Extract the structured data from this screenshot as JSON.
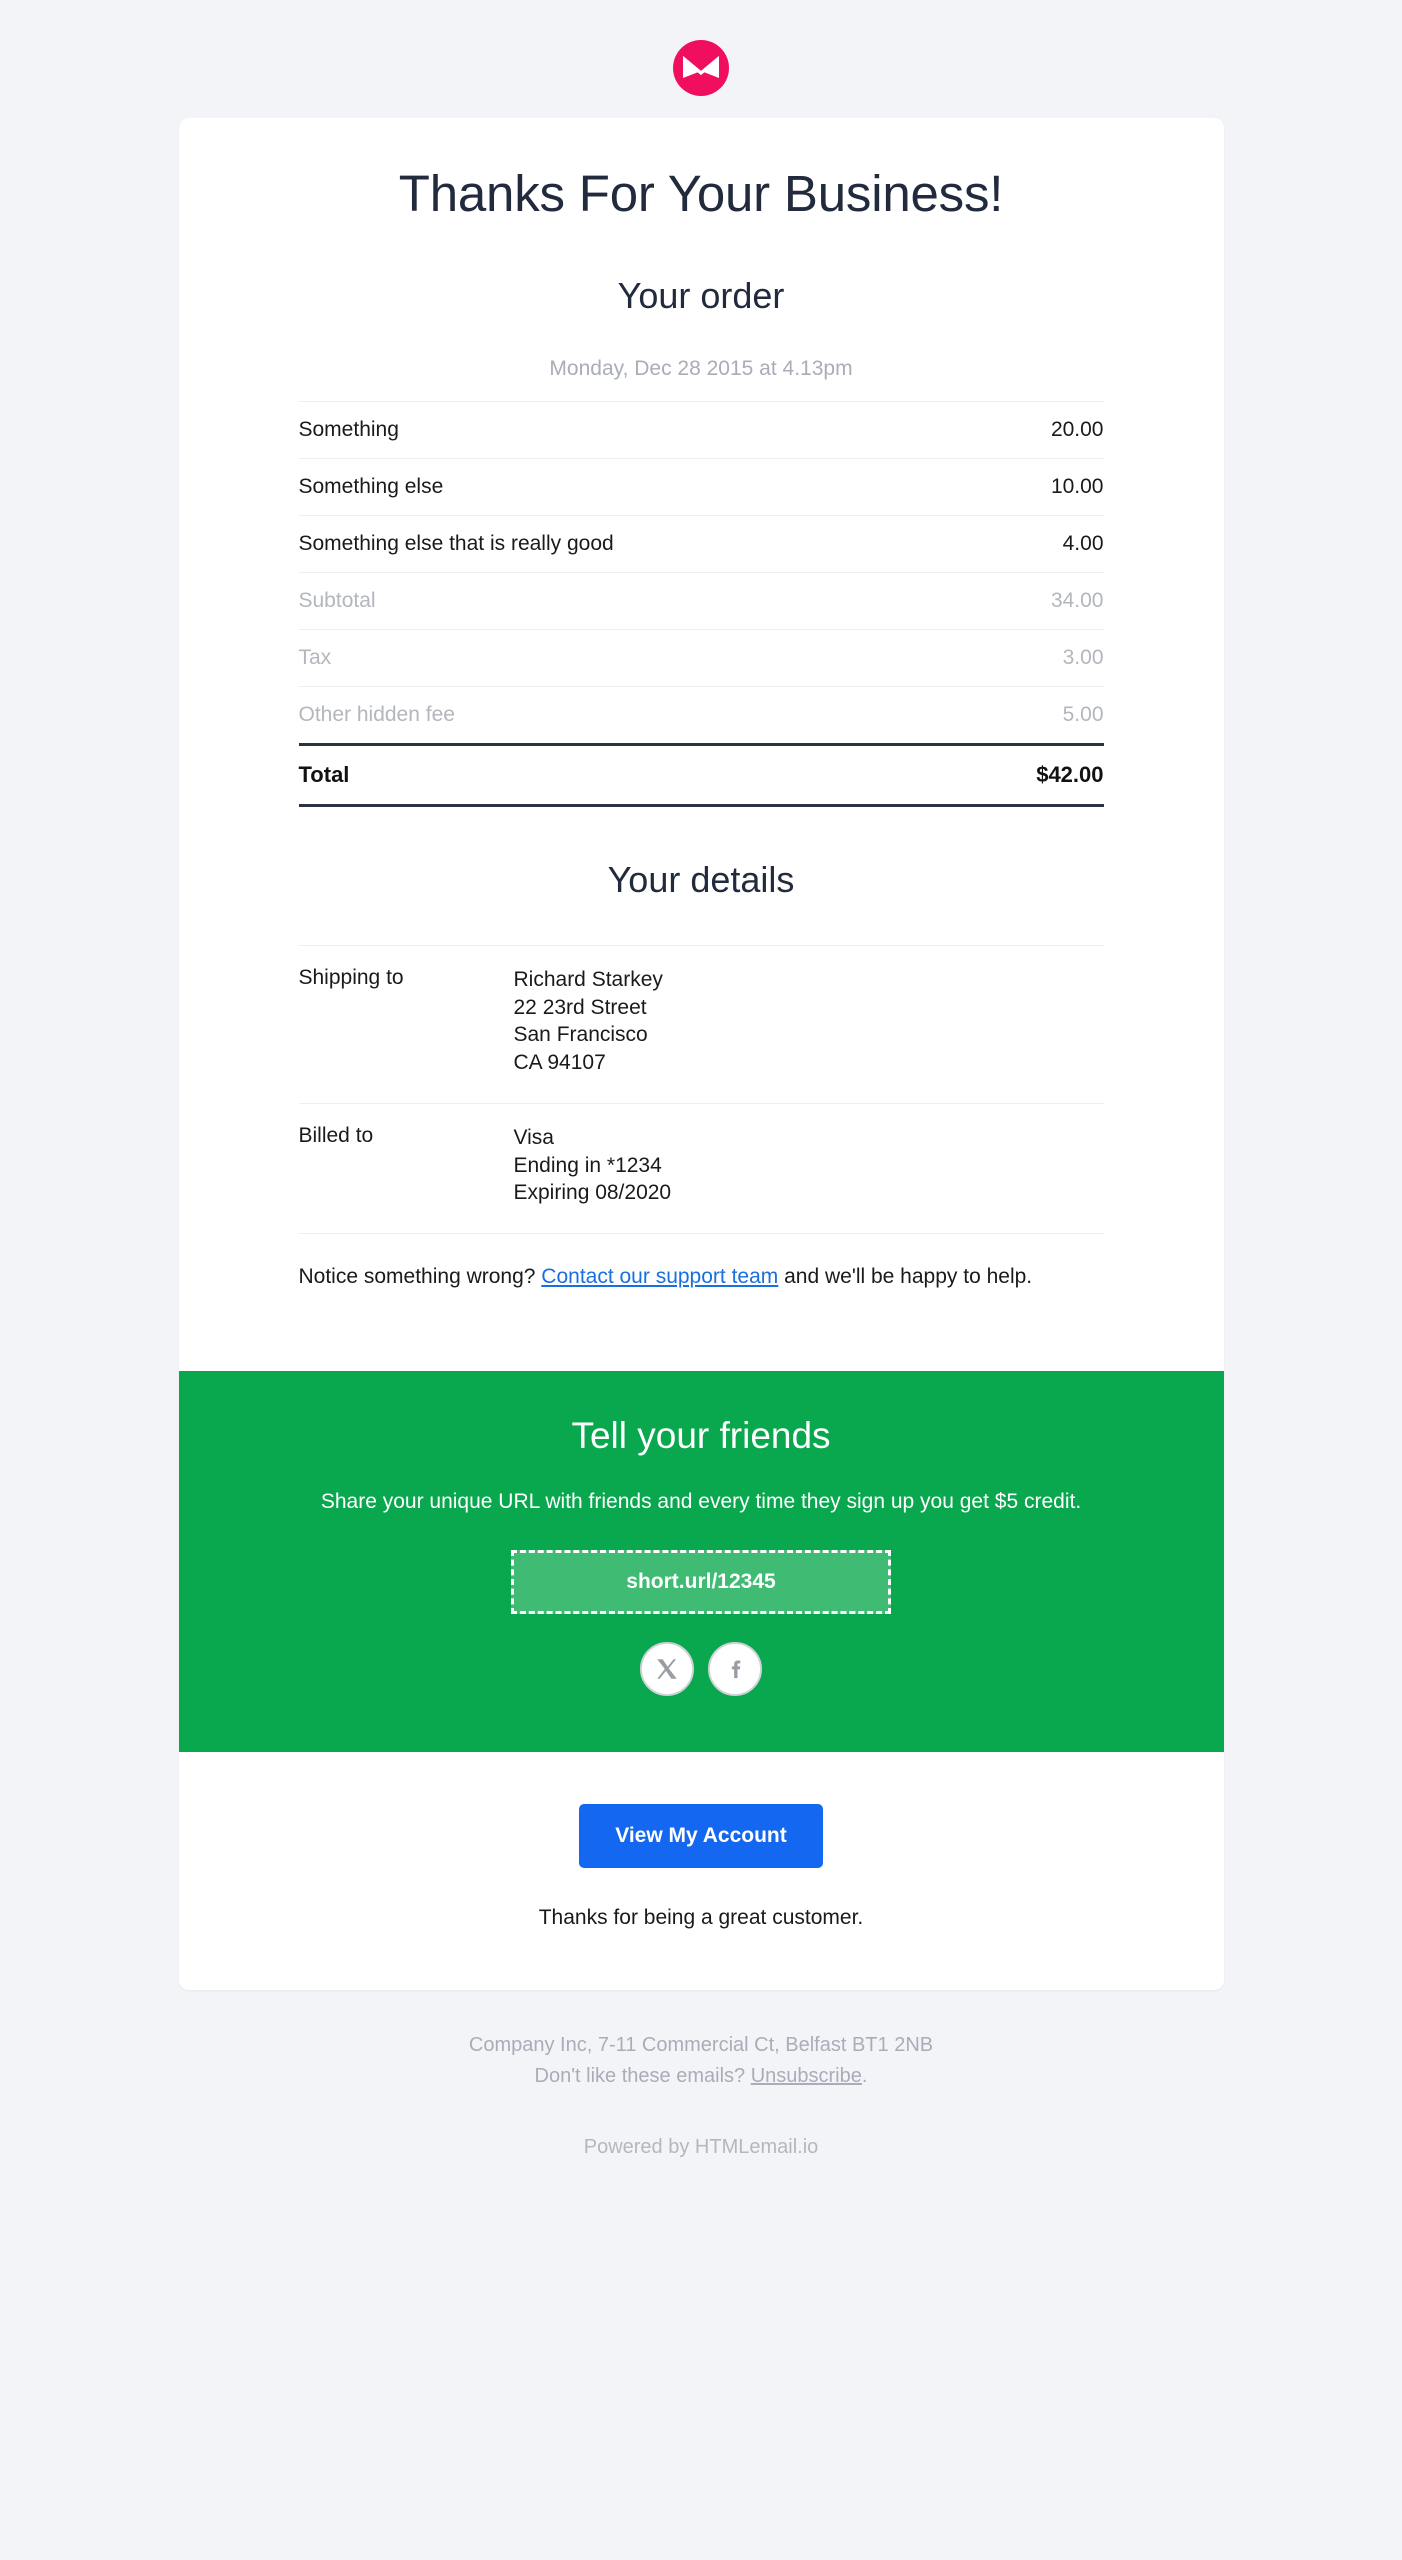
{
  "brand": {
    "logo_icon": "envelope-circle-logo",
    "logo_color": "#ef0f5e"
  },
  "header": {
    "title": "Thanks For Your Business!"
  },
  "order": {
    "heading": "Your order",
    "date": "Monday, Dec 28 2015 at 4.13pm",
    "items": [
      {
        "label": "Something",
        "amount": "20.00"
      },
      {
        "label": "Something else",
        "amount": "10.00"
      },
      {
        "label": "Something else that is really good",
        "amount": "4.00"
      }
    ],
    "adjustments": [
      {
        "label": "Subtotal",
        "amount": "34.00"
      },
      {
        "label": "Tax",
        "amount": "3.00"
      },
      {
        "label": "Other hidden fee",
        "amount": "5.00"
      }
    ],
    "total": {
      "label": "Total",
      "amount": "$42.00"
    }
  },
  "details": {
    "heading": "Your details",
    "shipping": {
      "label": "Shipping to",
      "line1": "Richard Starkey",
      "line2": "22 23rd Street",
      "line3": "San Francisco",
      "line4": "CA 94107"
    },
    "billing": {
      "label": "Billed to",
      "line1": "Visa",
      "line2": "Ending in *1234",
      "line3": "Expiring 08/2020"
    },
    "notice": {
      "before": "Notice something wrong? ",
      "link": "Contact our support team",
      "after": " and we'll be happy to help."
    }
  },
  "referral": {
    "heading": "Tell your friends",
    "blurb": "Share your unique URL with friends and every time they sign up you get $5 credit.",
    "url": "short.url/12345",
    "background_color": "#09a84e",
    "social": [
      {
        "name": "x-twitter",
        "label": "X"
      },
      {
        "name": "facebook",
        "label": "f"
      }
    ]
  },
  "cta": {
    "button_label": "View My Account",
    "button_color": "#1467f0",
    "thanks": "Thanks for being a great customer."
  },
  "footer": {
    "address": "Company Inc, 7-11 Commercial Ct, Belfast BT1 2NB",
    "unsub_before": "Don't like these emails? ",
    "unsub_link": "Unsubscribe",
    "unsub_after": ".",
    "powered": "Powered by HTMLemail.io"
  }
}
